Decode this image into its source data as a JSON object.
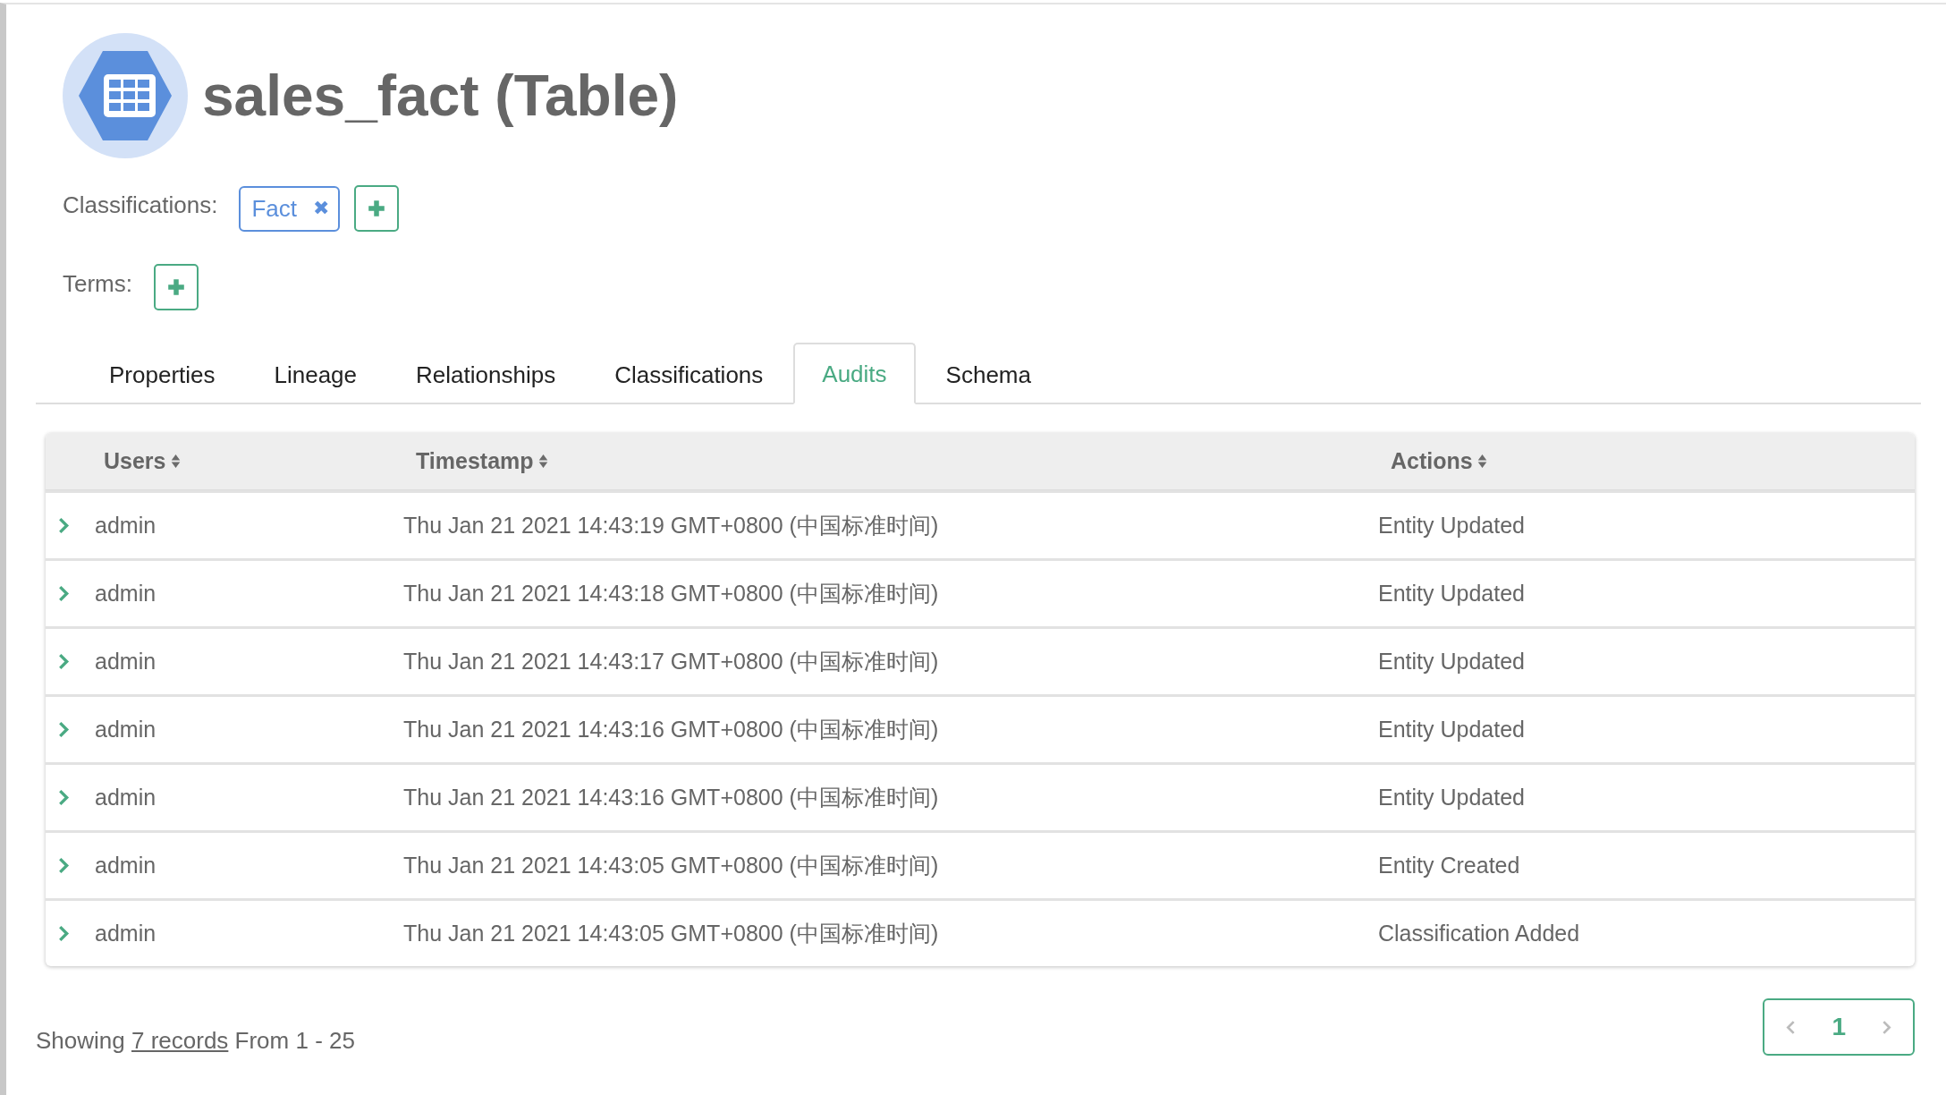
{
  "entity": {
    "name": "sales_fact (Table)"
  },
  "classifications": {
    "label": "Classifications:",
    "tags": [
      {
        "label": "Fact",
        "remove": "✖"
      }
    ]
  },
  "terms": {
    "label": "Terms:"
  },
  "tabs": [
    {
      "label": "Properties",
      "selected": false
    },
    {
      "label": "Lineage",
      "selected": false
    },
    {
      "label": "Relationships",
      "selected": false
    },
    {
      "label": "Classifications",
      "selected": false
    },
    {
      "label": "Audits",
      "selected": true
    },
    {
      "label": "Schema",
      "selected": false
    }
  ],
  "table": {
    "columns": [
      "Users",
      "Timestamp",
      "Actions"
    ],
    "rows": [
      {
        "expanded": false,
        "user": "admin",
        "timestamp": "Thu Jan 21 2021 14:43:19 GMT+0800 (中国标准时间)",
        "action": "Entity Updated"
      },
      {
        "expanded": false,
        "user": "admin",
        "timestamp": "Thu Jan 21 2021 14:43:18 GMT+0800 (中国标准时间)",
        "action": "Entity Updated"
      },
      {
        "expanded": false,
        "user": "admin",
        "timestamp": "Thu Jan 21 2021 14:43:17 GMT+0800 (中国标准时间)",
        "action": "Entity Updated"
      },
      {
        "expanded": false,
        "user": "admin",
        "timestamp": "Thu Jan 21 2021 14:43:16 GMT+0800 (中国标准时间)",
        "action": "Entity Updated"
      },
      {
        "expanded": false,
        "user": "admin",
        "timestamp": "Thu Jan 21 2021 14:43:16 GMT+0800 (中国标准时间)",
        "action": "Entity Updated"
      },
      {
        "expanded": false,
        "user": "admin",
        "timestamp": "Thu Jan 21 2021 14:43:05 GMT+0800 (中国标准时间)",
        "action": "Entity Created"
      },
      {
        "expanded": false,
        "user": "admin",
        "timestamp": "Thu Jan 21 2021 14:43:05 GMT+0800 (中国标准时间)",
        "action": "Classification Added"
      }
    ]
  },
  "footer": {
    "prefix": "Showing",
    "link": "7 records",
    "suffix": "From 1 - 25"
  },
  "pagination": {
    "pages": [
      {
        "label": "1",
        "selected": true
      }
    ]
  }
}
